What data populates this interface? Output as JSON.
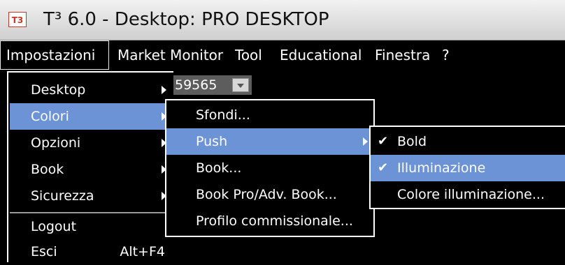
{
  "window": {
    "logo_text": "T3",
    "title": "T³ 6.0 - Desktop: PRO DESKTOP"
  },
  "menubar": {
    "items": [
      "Impostazioni",
      "Market Monitor",
      "Tool",
      "Educational",
      "Finestra",
      "?"
    ]
  },
  "combo": {
    "value": "59565"
  },
  "menu_impostazioni": {
    "items": [
      {
        "label": "Desktop",
        "submenu": true
      },
      {
        "label": "Colori",
        "submenu": true,
        "highlighted": true
      },
      {
        "label": "Opzioni",
        "submenu": true
      },
      {
        "label": "Book",
        "submenu": true
      },
      {
        "label": "Sicurezza",
        "submenu": true
      },
      {
        "label": "Logout"
      },
      {
        "label": "Esci",
        "shortcut": "Alt+F4"
      }
    ]
  },
  "menu_colori": {
    "items": [
      {
        "label": "Sfondi..."
      },
      {
        "label": "Push",
        "submenu": true,
        "highlighted": true
      },
      {
        "label": "Book..."
      },
      {
        "label": "Book Pro/Adv. Book..."
      },
      {
        "label": "Profilo commissionale..."
      }
    ]
  },
  "menu_push": {
    "items": [
      {
        "label": "Bold",
        "checked": true
      },
      {
        "label": "Illuminazione",
        "checked": true,
        "highlighted": true
      },
      {
        "label": "Colore illuminazione..."
      }
    ]
  },
  "colors": {
    "highlight": "#6b93d6",
    "menu_bg": "#000000",
    "menu_text": "#ffffff"
  },
  "icons": {
    "submenu": "triangle-right-icon",
    "check": "check-icon"
  }
}
